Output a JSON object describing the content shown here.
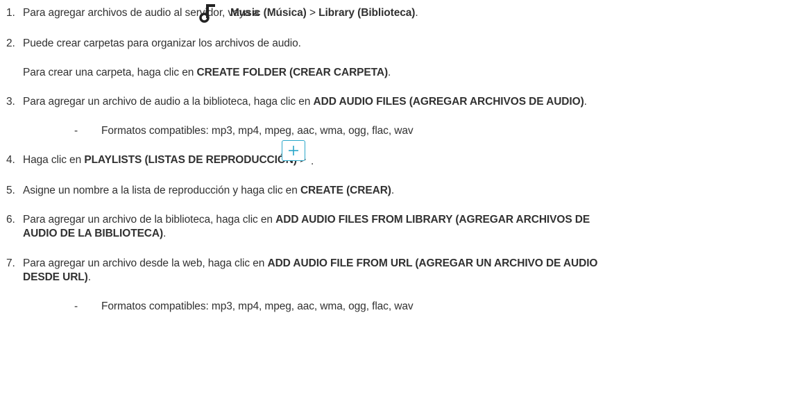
{
  "steps": [
    {
      "num": "1.",
      "pre": "Para agregar archivos de audio al servidor, vaya a",
      "icon": "music-note-icon",
      "b1": "Music (Música)",
      "sep": ">",
      "b2": "Library (Biblioteca)",
      "end": "."
    },
    {
      "num": "2.",
      "text": "Puede crear carpetas para organizar los archivos de audio."
    },
    {
      "pre": "Para crear una carpeta, haga clic en",
      "bold": "CREATE FOLDER (CREAR CARPETA)",
      "end": "."
    },
    {
      "num": "3.",
      "pre": "Para agregar un archivo de audio a la biblioteca, haga clic en",
      "bold": "ADD AUDIO FILES (AGREGAR ARCHIVOS DE AUDIO)",
      "end": "."
    },
    {
      "dash": "-",
      "text": "Formatos compatibles: mp3, mp4, mpeg, aac, wma, ogg, flac, wav"
    },
    {
      "num": "4.",
      "pre": "Haga clic en",
      "bold": "PLAYLISTS (LISTAS DE REPRODUCCIÓN)",
      "sep": ">",
      "icon": "plus-icon",
      "end": "."
    },
    {
      "num": "5.",
      "pre": "Asigne un nombre a la lista de reproducción y haga clic en",
      "bold": "CREATE (CREAR)",
      "end": "."
    },
    {
      "num": "6.",
      "pre": "Para agregar un archivo de la biblioteca, haga clic en",
      "bold": "ADD AUDIO FILES FROM LIBRARY (AGREGAR ARCHIVOS DE",
      "bold2": "AUDIO DE LA BIBLIOTECA)",
      "end": "."
    },
    {
      "num": "7.",
      "pre": "Para agregar un archivo desde la web, haga clic en",
      "bold": "ADD AUDIO FILE FROM URL (AGREGAR UN ARCHIVO DE AUDIO",
      "bold2": "DESDE URL)",
      "end": "."
    },
    {
      "dash": "-",
      "text": "Formatos compatibles: mp3, mp4, mpeg, aac, wma, ogg, flac, wav"
    }
  ],
  "colors": {
    "text": "#313131",
    "accent": "#2aa7c9"
  }
}
